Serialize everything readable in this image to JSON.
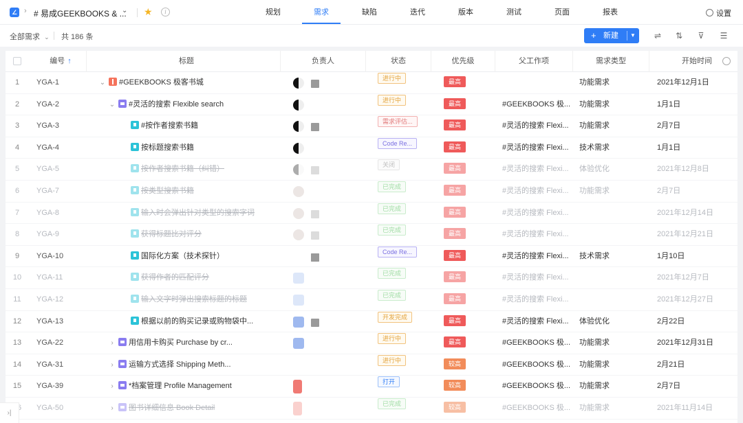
{
  "topbar": {
    "logo": "logo-icon",
    "project_title": "# 易成GEEKBOOKS & ...",
    "tabs": [
      {
        "label": "规划",
        "active": false
      },
      {
        "label": "需求",
        "active": true
      },
      {
        "label": "缺陷",
        "active": false
      },
      {
        "label": "迭代",
        "active": false
      },
      {
        "label": "版本",
        "active": false
      },
      {
        "label": "测试",
        "active": false
      },
      {
        "label": "页面",
        "active": false
      },
      {
        "label": "报表",
        "active": false
      }
    ],
    "settings_label": "设置"
  },
  "toolbar": {
    "filter_label": "全部需求",
    "count_label": "共 186 条",
    "new_button_label": "新建"
  },
  "table": {
    "columns": [
      "编号",
      "标题",
      "负责人",
      "状态",
      "优先级",
      "父工作项",
      "需求类型",
      "开始时间"
    ],
    "rows": [
      {
        "num": "1",
        "code": "YGA-1",
        "title": "#GEEKBOOKS 极客书城",
        "indent": 0,
        "expander": "⌄",
        "icon": "epic",
        "owner": "bw+sq",
        "status": "进行中",
        "status_type": "progress",
        "priority": "最高",
        "priority_type": "highest",
        "parent": "",
        "req_type": "功能需求",
        "start": "2021年12月1日",
        "faded": false
      },
      {
        "num": "2",
        "code": "YGA-2",
        "title": "#灵活的搜索 Flexible search",
        "indent": 1,
        "expander": "⌄",
        "icon": "feature",
        "owner": "bw",
        "status": "进行中",
        "status_type": "progress",
        "priority": "最高",
        "priority_type": "highest",
        "parent": "#GEEKBOOKS 极...",
        "req_type": "功能需求",
        "start": "1月1日",
        "faded": false
      },
      {
        "num": "3",
        "code": "YGA-3",
        "title": "#按作者搜索书籍",
        "indent": 2,
        "expander": "",
        "icon": "story",
        "owner": "bw+sq",
        "status": "需求评估...",
        "status_type": "review",
        "priority": "最高",
        "priority_type": "highest",
        "parent": "#灵活的搜索 Flexi...",
        "req_type": "功能需求",
        "start": "2月7日",
        "faded": false
      },
      {
        "num": "4",
        "code": "YGA-4",
        "title": "按标题搜索书籍",
        "indent": 2,
        "expander": "",
        "icon": "story",
        "owner": "bw",
        "status": "Code Re...",
        "status_type": "code",
        "priority": "最高",
        "priority_type": "highest",
        "parent": "#灵活的搜索 Flexi...",
        "req_type": "技术需求",
        "start": "1月1日",
        "faded": false
      },
      {
        "num": "5",
        "code": "YGA-5",
        "title": "按作者搜索书籍（纠错）",
        "indent": 2,
        "expander": "",
        "icon": "story",
        "owner": "bw+sq",
        "status": "关闭",
        "status_type": "closed",
        "priority": "最高",
        "priority_type": "highest",
        "parent": "#灵活的搜索 Flexi...",
        "req_type": "体验优化",
        "start": "2021年12月8日",
        "faded": true
      },
      {
        "num": "6",
        "code": "YGA-7",
        "title": "按类型搜索书籍",
        "indent": 2,
        "expander": "",
        "icon": "story",
        "owner": "photo",
        "status": "已完成",
        "status_type": "done",
        "priority": "最高",
        "priority_type": "highest",
        "parent": "#灵活的搜索 Flexi...",
        "req_type": "功能需求",
        "start": "2月7日",
        "faded": true
      },
      {
        "num": "7",
        "code": "YGA-8",
        "title": "输入时会弹出针对类型的搜索字词",
        "indent": 2,
        "expander": "",
        "icon": "story",
        "owner": "photo+sq",
        "status": "已完成",
        "status_type": "done",
        "priority": "最高",
        "priority_type": "highest",
        "parent": "#灵活的搜索 Flexi...",
        "req_type": "",
        "start": "2021年12月14日",
        "faded": true
      },
      {
        "num": "8",
        "code": "YGA-9",
        "title": "获得标题比对评分",
        "indent": 2,
        "expander": "",
        "icon": "story",
        "owner": "photo+sq",
        "status": "已完成",
        "status_type": "done",
        "priority": "最高",
        "priority_type": "highest",
        "parent": "#灵活的搜索 Flexi...",
        "req_type": "",
        "start": "2021年12月21日",
        "faded": true
      },
      {
        "num": "9",
        "code": "YGA-10",
        "title": "国际化方案（技术探针）",
        "indent": 2,
        "expander": "",
        "icon": "story",
        "owner": "sq+folder",
        "status": "Code Re...",
        "status_type": "code",
        "priority": "最高",
        "priority_type": "highest",
        "parent": "#灵活的搜索 Flexi...",
        "req_type": "技术需求",
        "start": "1月10日",
        "faded": false
      },
      {
        "num": "10",
        "code": "YGA-11",
        "title": "获得作者的匹配评分",
        "indent": 2,
        "expander": "",
        "icon": "story",
        "owner": "blue",
        "status": "已完成",
        "status_type": "done",
        "priority": "最高",
        "priority_type": "highest",
        "parent": "#灵活的搜索 Flexi...",
        "req_type": "",
        "start": "2021年12月7日",
        "faded": true
      },
      {
        "num": "11",
        "code": "YGA-12",
        "title": "输入文字时弹出搜索标题的标题",
        "indent": 2,
        "expander": "",
        "icon": "story",
        "owner": "blue",
        "status": "已完成",
        "status_type": "done",
        "priority": "最高",
        "priority_type": "highest",
        "parent": "#灵活的搜索 Flexi...",
        "req_type": "",
        "start": "2021年12月27日",
        "faded": true
      },
      {
        "num": "12",
        "code": "YGA-13",
        "title": "根据以前的购买记录或购物袋中...",
        "indent": 2,
        "expander": "",
        "icon": "story",
        "owner": "blue+sq",
        "status": "开发完成",
        "status_type": "devdone",
        "priority": "最高",
        "priority_type": "highest",
        "parent": "#灵活的搜索 Flexi...",
        "req_type": "体验优化",
        "start": "2月22日",
        "faded": false
      },
      {
        "num": "13",
        "code": "YGA-22",
        "title": "用信用卡购买 Purchase by cr...",
        "indent": 1,
        "expander": "›",
        "icon": "feature",
        "owner": "blue",
        "status": "进行中",
        "status_type": "progress",
        "priority": "最高",
        "priority_type": "highest",
        "parent": "#GEEKBOOKS 极...",
        "req_type": "功能需求",
        "start": "2021年12月31日",
        "faded": false
      },
      {
        "num": "14",
        "code": "YGA-31",
        "title": "运输方式选择 Shipping Meth...",
        "indent": 1,
        "expander": "›",
        "icon": "feature",
        "owner": "",
        "status": "进行中",
        "status_type": "progress",
        "priority": "较高",
        "priority_type": "high",
        "parent": "#GEEKBOOKS 极...",
        "req_type": "功能需求",
        "start": "2月21日",
        "faded": false
      },
      {
        "num": "15",
        "code": "YGA-39",
        "title": "*档案管理 Profile Management",
        "indent": 1,
        "expander": "›",
        "icon": "feature",
        "owner": "red",
        "status": "打开",
        "status_type": "open",
        "priority": "较高",
        "priority_type": "high",
        "parent": "#GEEKBOOKS 极...",
        "req_type": "功能需求",
        "start": "2月7日",
        "faded": false
      },
      {
        "num": "16",
        "code": "YGA-50",
        "title": "图书详细信息 Book Detail",
        "indent": 1,
        "expander": "›",
        "icon": "feature",
        "owner": "red",
        "status": "已完成",
        "status_type": "done",
        "priority": "较高",
        "priority_type": "high",
        "parent": "#GEEKBOOKS 极...",
        "req_type": "功能需求",
        "start": "2021年11月14日",
        "faded": true
      }
    ]
  }
}
